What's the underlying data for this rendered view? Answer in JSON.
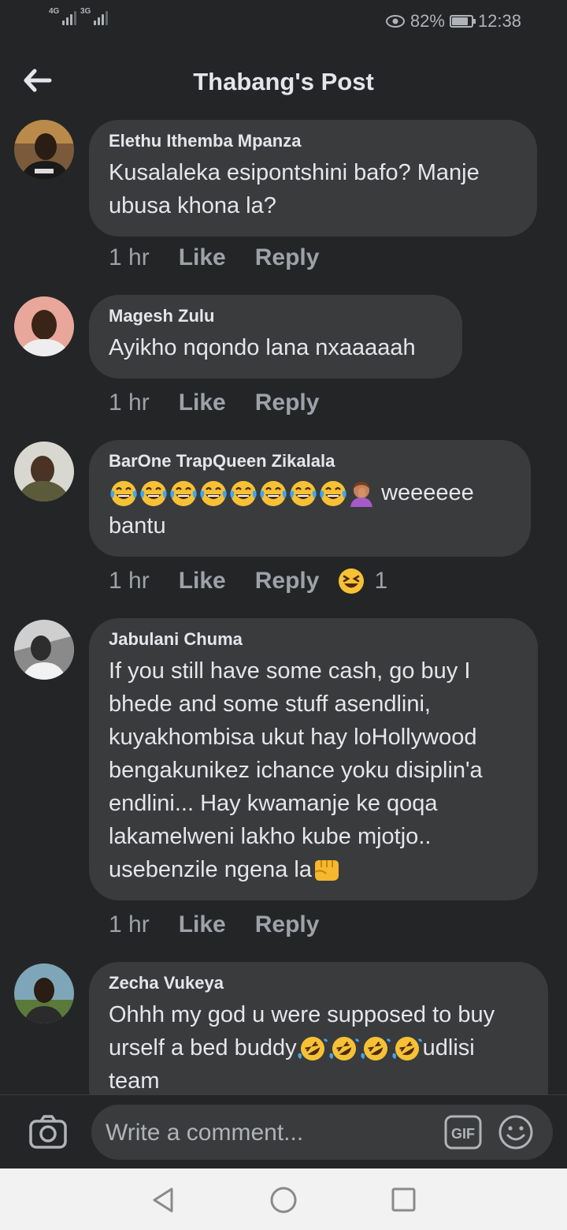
{
  "status_bar": {
    "network1": "4G",
    "network2": "3G",
    "battery_percent": "82%",
    "battery_level": 0.82,
    "time": "12:38"
  },
  "header": {
    "title": "Thabang's Post",
    "back_icon": "arrow-left-icon"
  },
  "comments": [
    {
      "author": "Elethu Ithemba Mpanza",
      "text": "Kusalaleka esipontshini bafo? Manje ubusa khona la?",
      "time": "1 hr",
      "like": "Like",
      "reply": "Reply"
    },
    {
      "author": "Magesh Zulu",
      "text": "Ayikho nqondo lana nxaaaaah",
      "time": "1 hr",
      "like": "Like",
      "reply": "Reply"
    },
    {
      "author": "BarOne TrapQueen Zikalala",
      "text": "weeeeee bantu",
      "time": "1 hr",
      "like": "Like",
      "reply": "Reply",
      "reaction_icon": "laughing-squint-emoji",
      "reaction_count": "1"
    },
    {
      "author": "Jabulani Chuma",
      "text": "If you still have some cash, go buy I bhede and some stuff asendlini, kuyakhombisa ukut hay loHollywood bengakunikez ichance yoku disiplin'a endlini... Hay kwamanje ke qoqa lakamelweni lakho kube mjotjo.. usebenzile ngena la",
      "time": "1 hr",
      "like": "Like",
      "reply": "Reply"
    },
    {
      "author": "Zecha Vukeya",
      "text_part1": "Ohhh my god u were supposed to buy urself a bed buddy",
      "text_part2": "udlisi team"
    }
  ],
  "composer": {
    "placeholder": "Write a comment...",
    "gif_label": "GIF"
  },
  "colors": {
    "background": "#242526",
    "bubble": "#3a3b3c",
    "text": "#e4e6eb",
    "muted": "#9ea2a8"
  }
}
